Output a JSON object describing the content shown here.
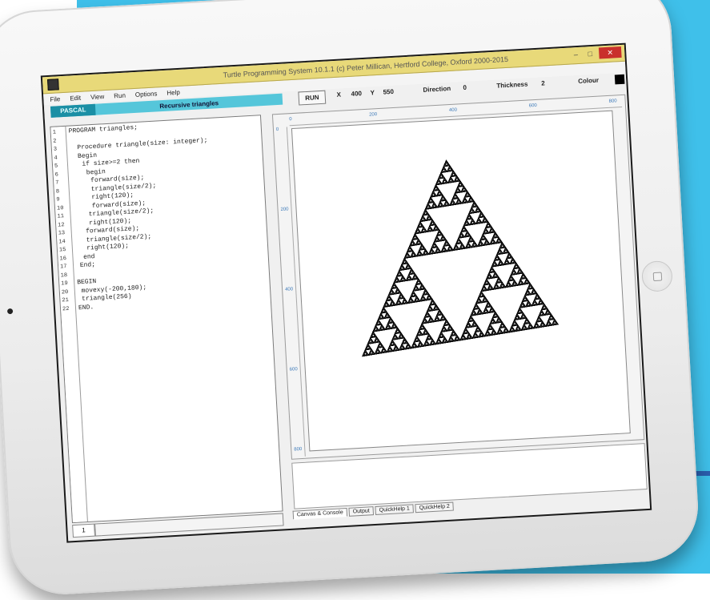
{
  "window": {
    "title": "Turtle Programming System 10.1.1 (c) Peter Millican, Hertford College, Oxford 2000-2015",
    "controls": {
      "minimize": "–",
      "maximize": "□",
      "close": "✕"
    }
  },
  "menu": [
    "File",
    "Edit",
    "View",
    "Run",
    "Options",
    "Help"
  ],
  "toolbar": {
    "language": "PASCAL",
    "program_title": "Recursive triangles",
    "run_label": "RUN",
    "x_label": "X",
    "x_value": "400",
    "y_label": "Y",
    "y_value": "550",
    "direction_label": "Direction",
    "direction_value": "0",
    "thickness_label": "Thickness",
    "thickness_value": "2",
    "colour_label": "Colour",
    "colour_value": "#000000"
  },
  "code_lines": [
    "PROGRAM triangles;",
    "",
    "  Procedure triangle(size: integer);",
    "  Begin",
    "   if size>=2 then",
    "    begin",
    "     forward(size);",
    "     triangle(size/2);",
    "     right(120);",
    "     forward(size);",
    "    triangle(size/2);",
    "    right(120);",
    "   forward(size);",
    "   triangle(size/2);",
    "   right(120);",
    "  end",
    " End;",
    "",
    "BEGIN",
    " movexy(-200,180);",
    " triangle(256)",
    "END."
  ],
  "status": {
    "line_indicator": "1"
  },
  "canvas": {
    "ruler_top": [
      "0",
      "200",
      "400",
      "600",
      "800"
    ],
    "ruler_left": [
      "0",
      "200",
      "400",
      "600",
      "800"
    ],
    "fractal": {
      "type": "sierpinski-triangle",
      "depth": 7
    }
  },
  "tabs": [
    "Canvas & Console",
    "Output",
    "QuickHelp 1",
    "QuickHelp 2"
  ],
  "colors": {
    "background_blue": "#3fc0ea",
    "accent_dark_blue": "#2b5fae",
    "title_bar": "#e8d979",
    "language_bar": "#55c6da"
  }
}
